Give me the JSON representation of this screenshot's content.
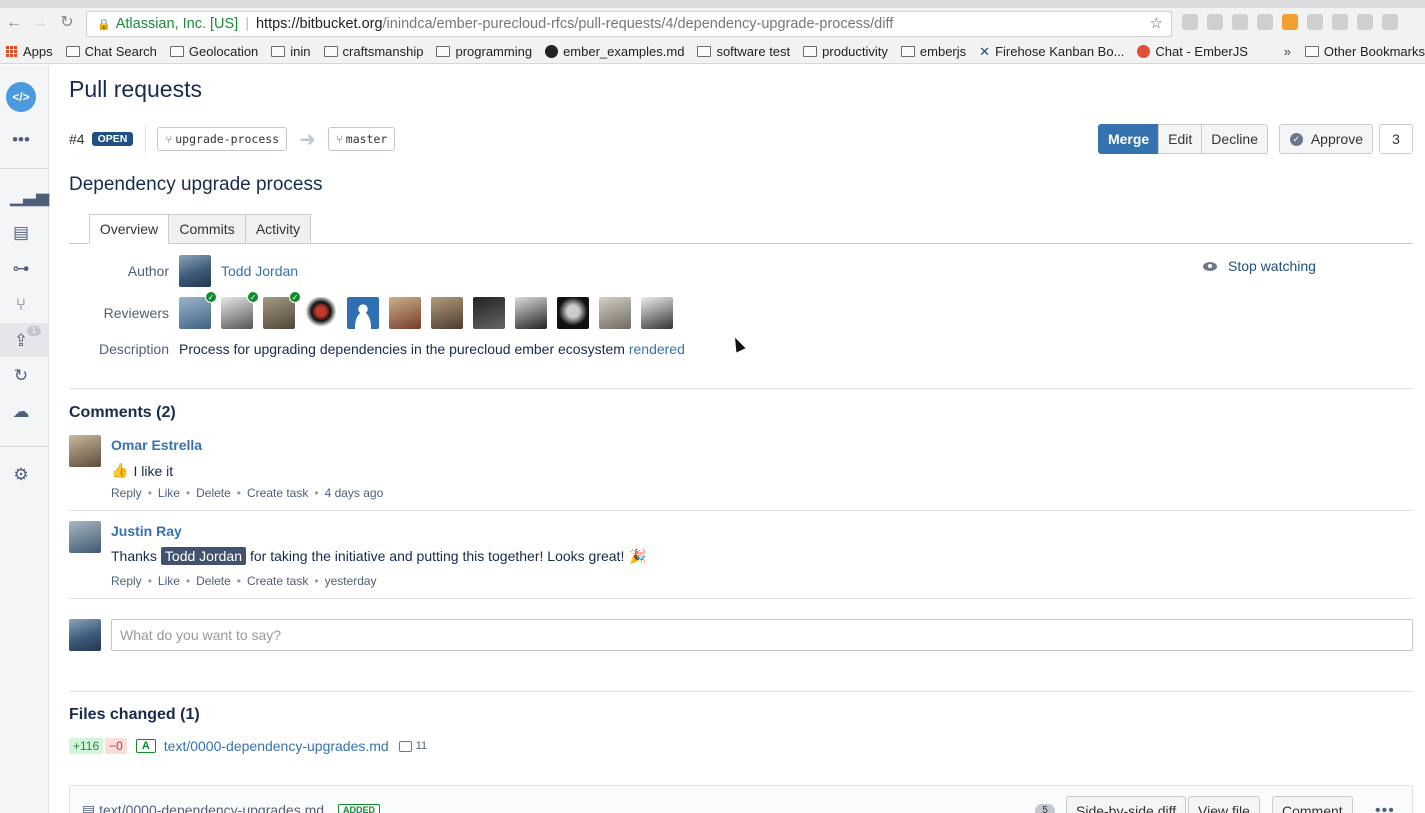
{
  "browser": {
    "url_secure_label": "Atlassian, Inc. [US]",
    "url_domain": "https://bitbucket.org",
    "url_path": "/inindca/ember-purecloud-rfcs/pull-requests/4/dependency-upgrade-process/diff",
    "bookmarks": [
      "Apps",
      "Chat Search",
      "Geolocation",
      "inin",
      "craftsmanship",
      "programming",
      "ember_examples.md",
      "software test",
      "productivity",
      "emberjs",
      "Firehose Kanban Bo...",
      "Chat - EmberJS"
    ],
    "bookmarks_more": "»",
    "other_bookmarks": "Other Bookmarks"
  },
  "sidebar": {
    "logo": "</>",
    "badge": "1",
    "icons": [
      "more-icon",
      "chart-icon",
      "document-icon",
      "commit-icon",
      "branch-icon",
      "pull-request-icon",
      "sync-icon",
      "deploy-icon",
      "settings-icon"
    ]
  },
  "page": {
    "title": "Pull requests",
    "pr_number": "#4",
    "pr_status": "OPEN",
    "source_branch": "upgrade-process",
    "target_branch": "master",
    "pr_title": "Dependency upgrade process"
  },
  "actions": {
    "merge": "Merge",
    "edit": "Edit",
    "decline": "Decline",
    "approve": "Approve",
    "approve_count": "3"
  },
  "tabs": [
    "Overview",
    "Commits",
    "Activity"
  ],
  "overview": {
    "author_label": "Author",
    "author_name": "Todd Jordan",
    "reviewers_label": "Reviewers",
    "description_label": "Description",
    "description_text": "Process for upgrading dependencies in the purecloud ember ecosystem",
    "description_link": "rendered",
    "watch": "Stop watching"
  },
  "comments": {
    "title": "Comments (2)",
    "items": [
      {
        "author": "Omar Estrella",
        "text": "I like it",
        "emoji": "👍",
        "actions": [
          "Reply",
          "Like",
          "Delete",
          "Create task"
        ],
        "time": "4 days ago"
      },
      {
        "author": "Justin Ray",
        "text_before": "Thanks",
        "mention": "Todd Jordan",
        "text_after": "for taking the initiative and putting this together! Looks great!",
        "emoji": "🎉",
        "actions": [
          "Reply",
          "Like",
          "Delete",
          "Create task"
        ],
        "time": "yesterday"
      }
    ],
    "reply_placeholder": "What do you want to say?"
  },
  "files": {
    "title": "Files changed (1)",
    "added_lines": "+116",
    "removed_lines": "−0",
    "status": "A",
    "path": "text/0000-dependency-upgrades.md",
    "comment_count": "11",
    "diff_header": {
      "filename": "text/0000-dependency-upgrades.md",
      "badge": "ADDED",
      "count": "5",
      "side_by_side": "Side-by-side diff",
      "view_file": "View file",
      "comment": "Comment",
      "more": "•••"
    }
  }
}
